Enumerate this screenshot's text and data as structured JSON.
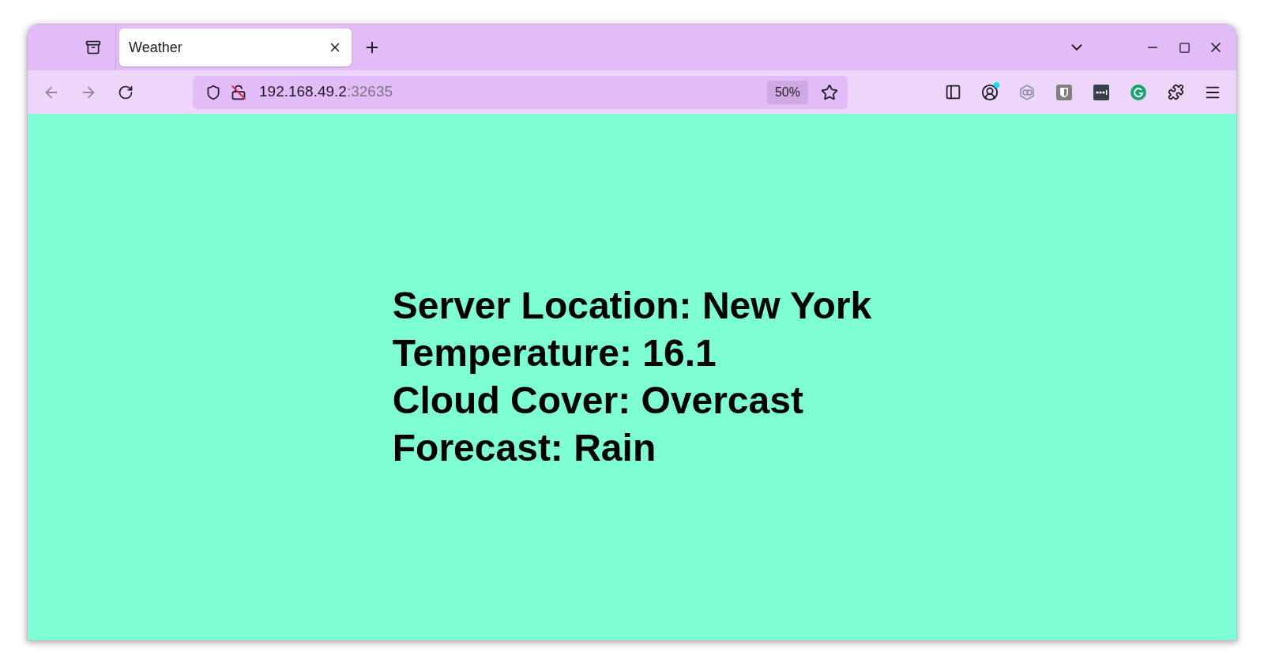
{
  "tab": {
    "title": "Weather",
    "selected": true
  },
  "address_bar": {
    "host": "192.168.49.2",
    "port": ":32635",
    "zoom": "50%"
  },
  "content": {
    "lines": [
      "Server Location: New York",
      "Temperature: 16.1",
      "Cloud Cover: Overcast",
      "Forecast: Rain"
    ]
  }
}
